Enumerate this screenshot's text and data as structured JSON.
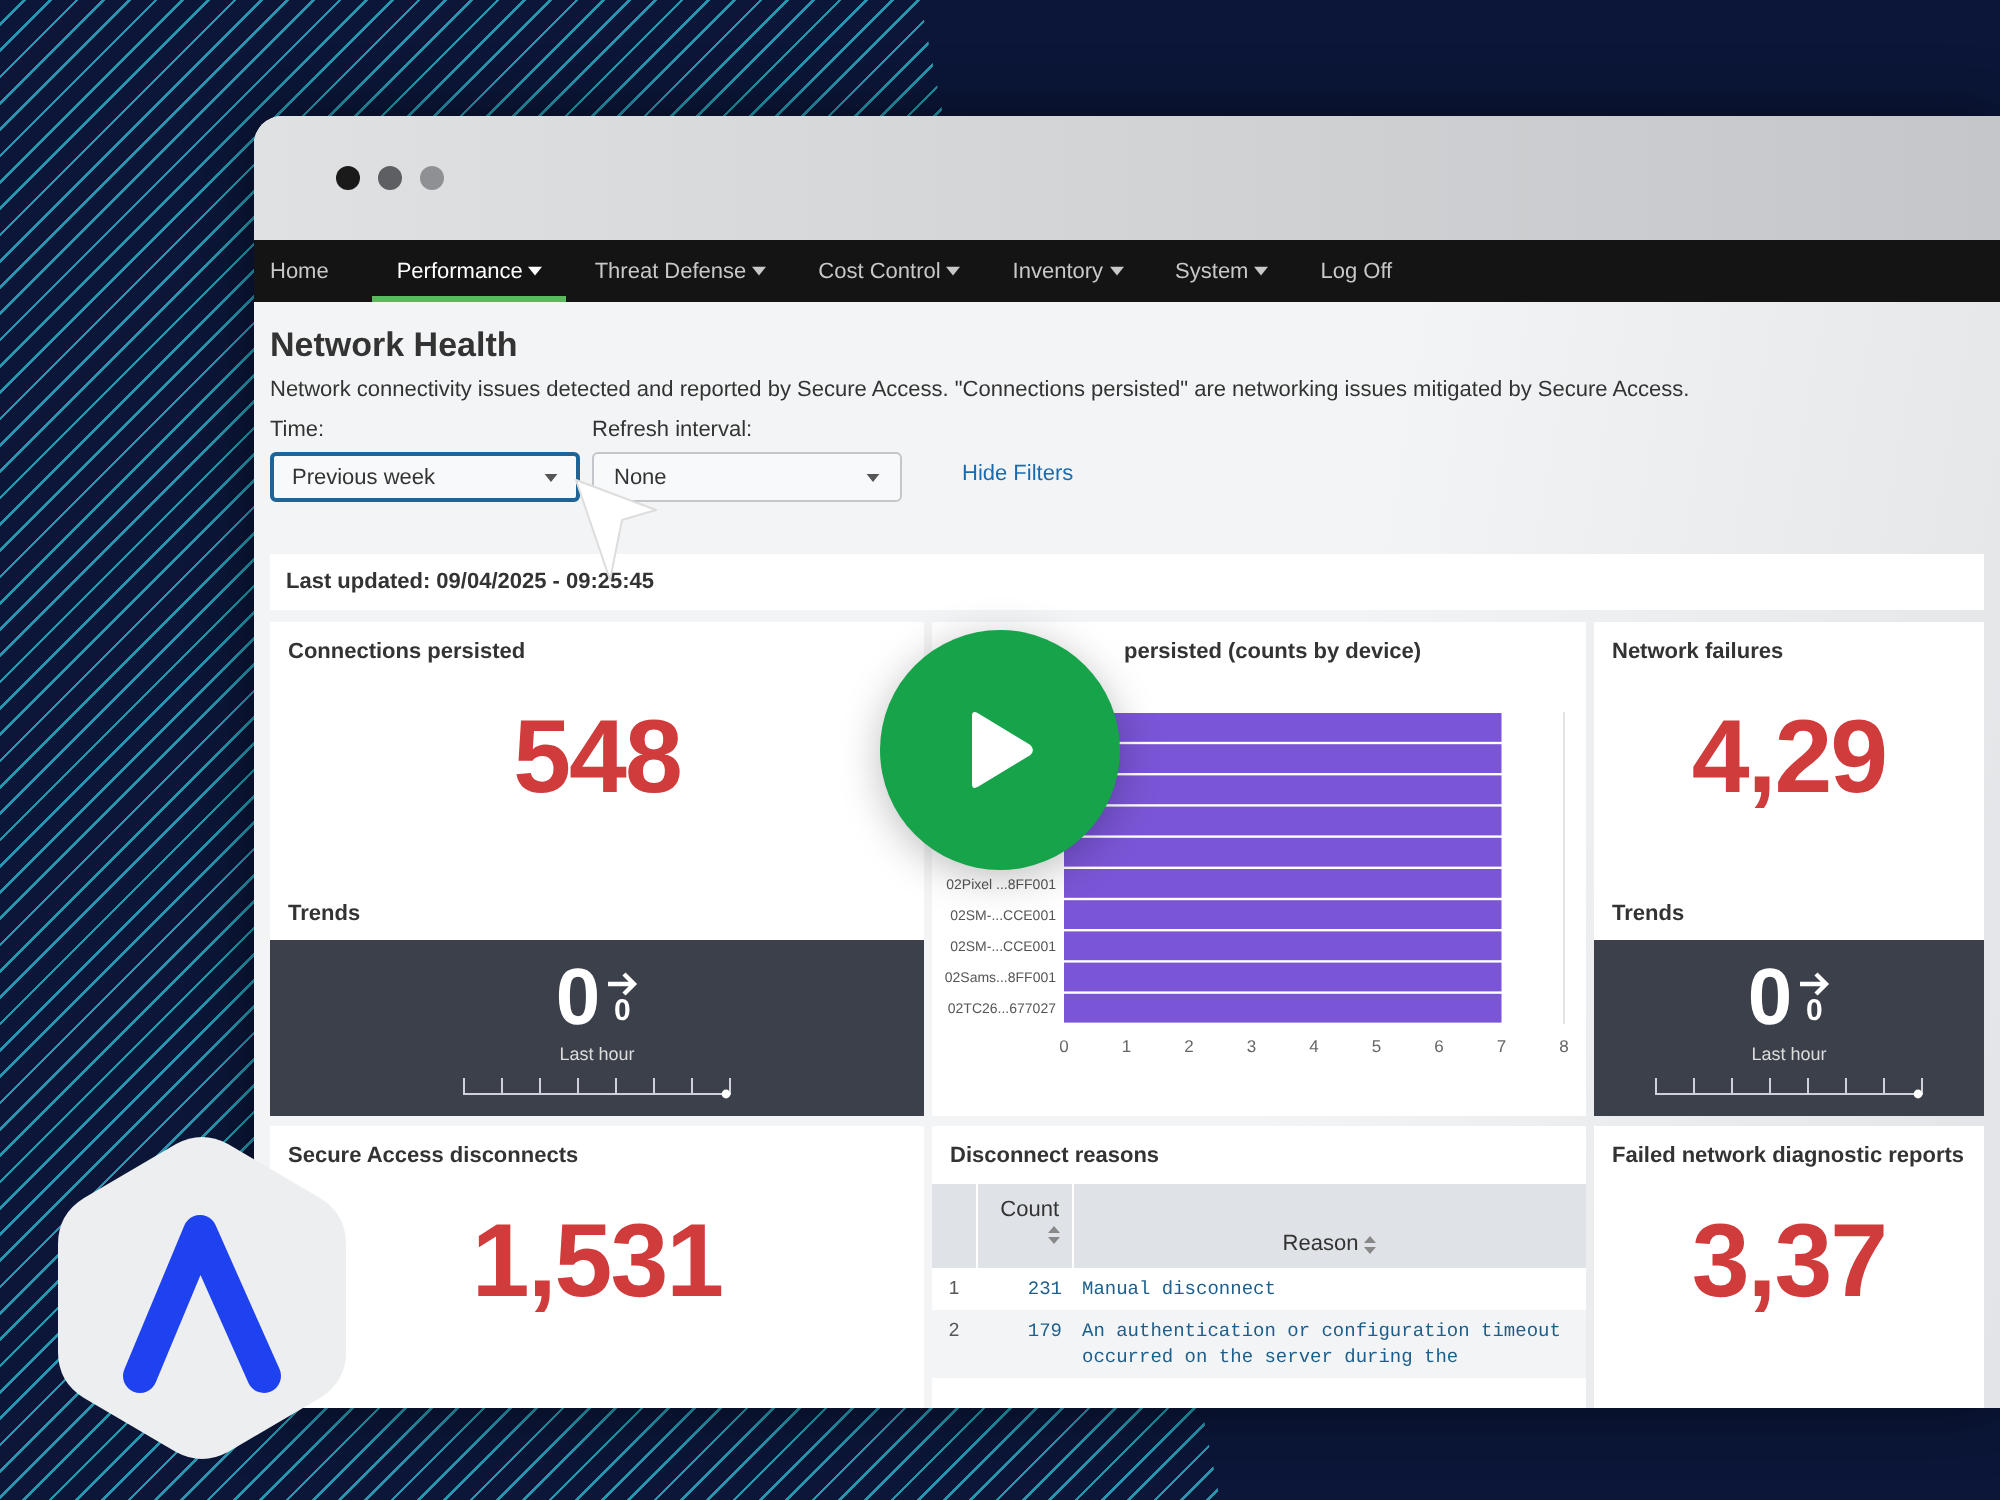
{
  "nav": [
    {
      "label": "Home",
      "selected": false,
      "dropdown": false
    },
    {
      "label": "Performance",
      "selected": true,
      "dropdown": true
    },
    {
      "label": "Threat Defense",
      "selected": false,
      "dropdown": true
    },
    {
      "label": "Cost Control",
      "selected": false,
      "dropdown": true
    },
    {
      "label": "Inventory",
      "selected": false,
      "dropdown": true
    },
    {
      "label": "System",
      "selected": false,
      "dropdown": true
    },
    {
      "label": "Log Off",
      "selected": false,
      "dropdown": false
    }
  ],
  "page": {
    "title": "Network Health",
    "description": "Network connectivity issues detected and reported by Secure Access. \"Connections persisted\" are networking issues mitigated by Secure Access."
  },
  "filters": [
    {
      "label": "Time:",
      "value": "Previous week",
      "focused": true
    },
    {
      "label": "Refresh interval:",
      "value": "None",
      "focused": false
    }
  ],
  "hide_filters": "Hide Filters",
  "last_updated": "Last updated: 09/04/2025 - 09:25:45",
  "panels": [
    {
      "kind": "single_value",
      "title": "Connections persisted",
      "value": "548",
      "trends": {
        "label": "Trends",
        "value": "0",
        "change": "0",
        "period": "Last hour"
      }
    },
    {
      "kind": "chart",
      "chart_data": {
        "type": "bar",
        "orientation": "horizontal",
        "title": "persisted (counts by device)",
        "categories": [
          null,
          null,
          null,
          null,
          null,
          "02Pixel ...8FF001",
          "02SM-...CCE001",
          "02SM-...CCE001",
          "02Sams...8FF001",
          "02TC26...677027"
        ],
        "values": [
          7,
          7,
          7,
          7,
          7,
          7,
          7,
          7,
          7,
          7
        ],
        "xlim": [
          0,
          8
        ],
        "xticks": [
          0,
          1,
          2,
          3,
          4,
          5,
          6,
          7,
          8
        ]
      }
    },
    {
      "kind": "single_value",
      "title": "Network failures",
      "value": "4,29",
      "trends": {
        "label": "Trends",
        "value": "0",
        "change": "0",
        "period": "Last hour"
      }
    },
    {
      "kind": "single_value",
      "title": "Secure Access disconnects",
      "value": "1,531"
    },
    {
      "kind": "table",
      "title": "Disconnect reasons",
      "columns": [
        {
          "label": "Count",
          "sortable": true
        },
        {
          "label": "Reason",
          "sortable": true
        }
      ],
      "rows": [
        {
          "index": "1",
          "count": "231",
          "reason": "Manual disconnect"
        },
        {
          "index": "2",
          "count": "179",
          "reason": "An authentication or configuration timeout occurred on the server during the"
        }
      ]
    },
    {
      "kind": "single_value",
      "title": "Failed network diagnostic reports",
      "value": "3,37"
    }
  ]
}
